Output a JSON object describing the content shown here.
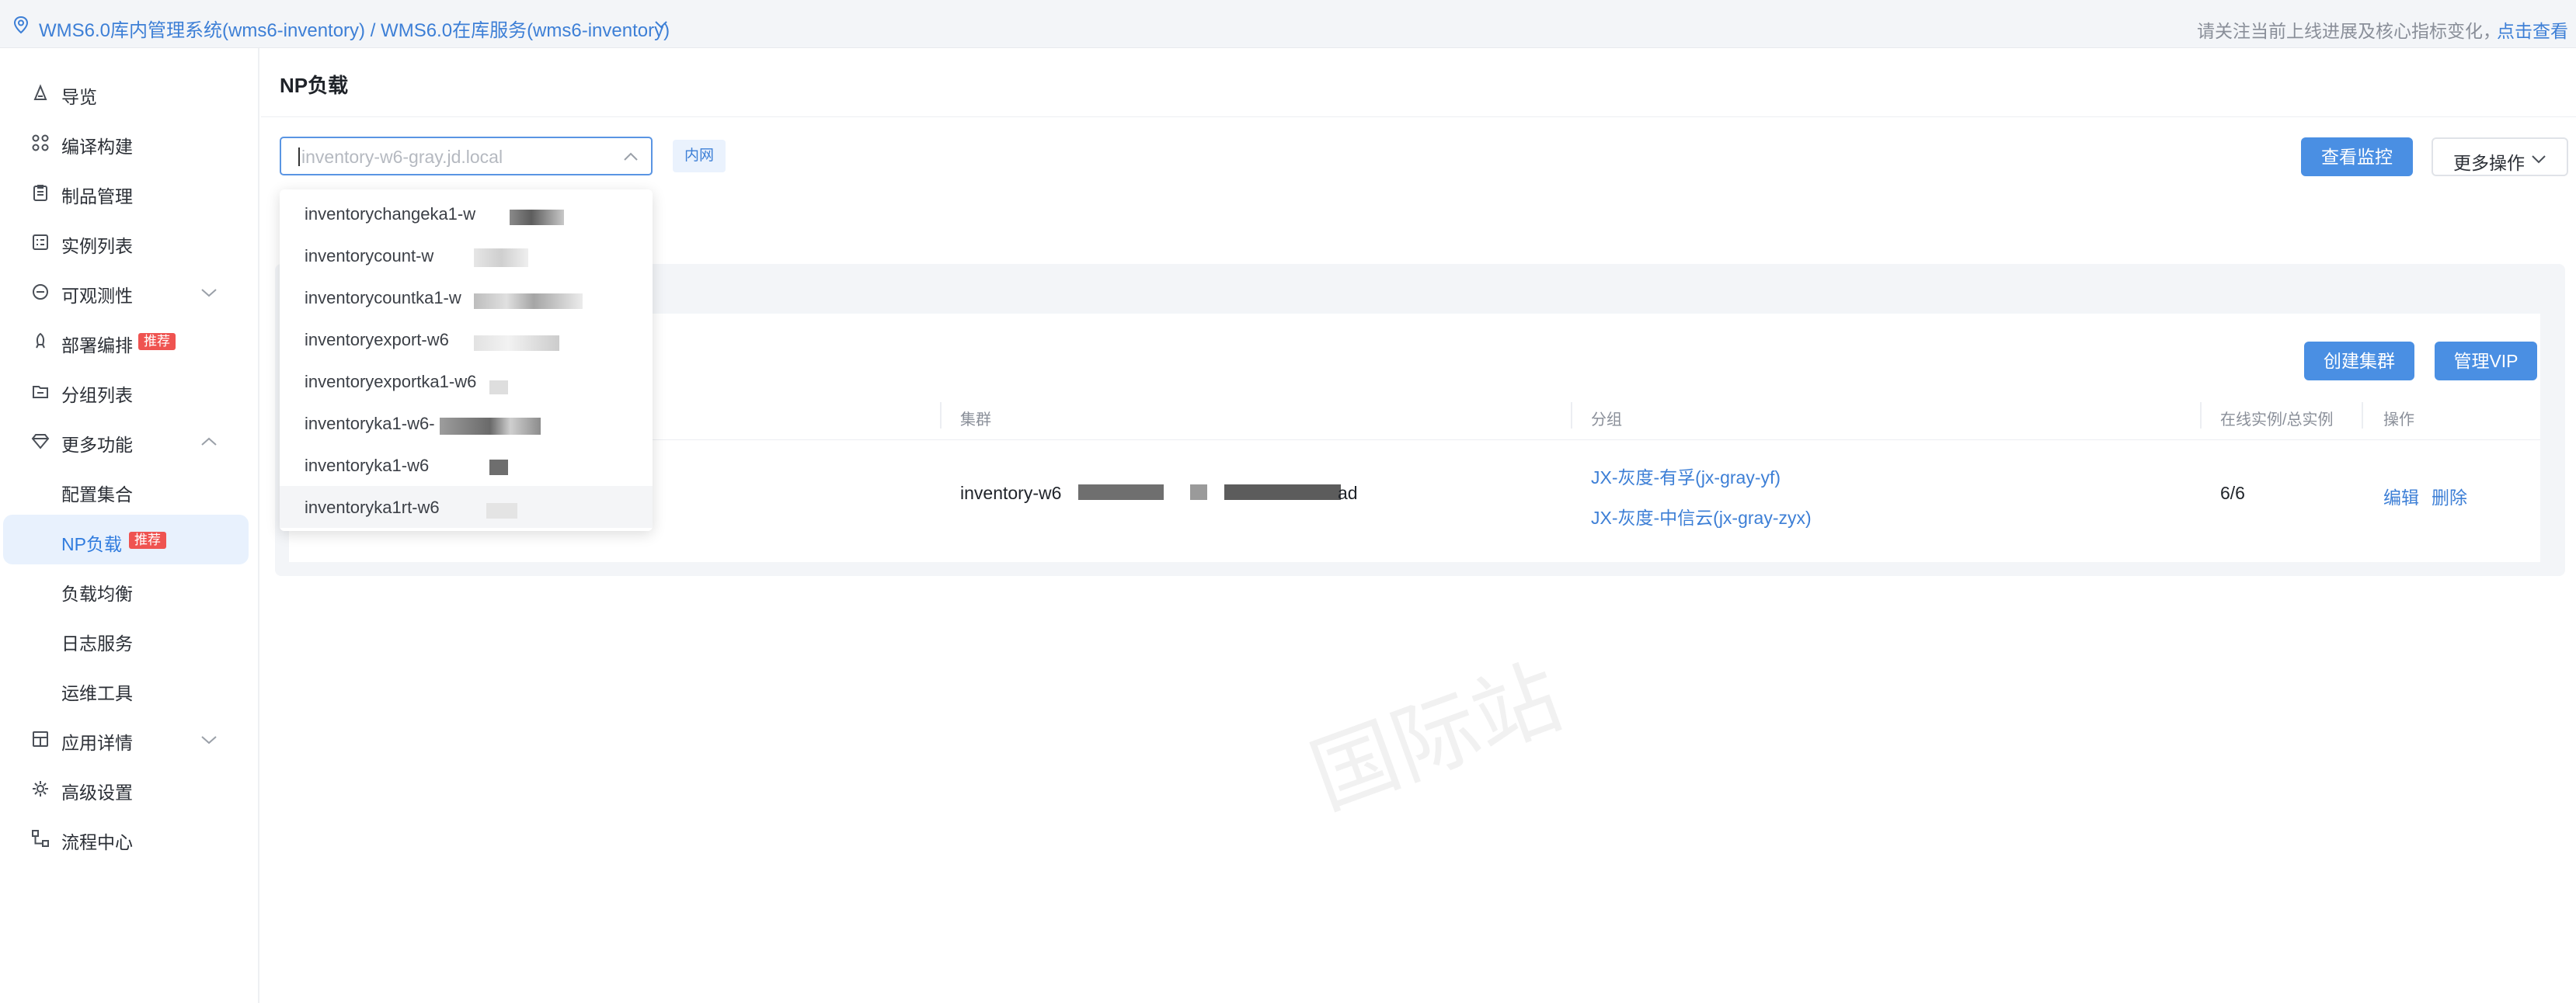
{
  "topbar": {
    "breadcrumb": "WMS6.0库内管理系统(wms6-inventory) / WMS6.0在库服务(wms6-inventory)",
    "notice": "请关注当前上线进展及核心指标变化，",
    "notice_link": "点击查看"
  },
  "sidebar": {
    "items": [
      {
        "label": "导览",
        "icon": "home-icon"
      },
      {
        "label": "编译构建",
        "icon": "build-icon"
      },
      {
        "label": "制品管理",
        "icon": "clipboard-icon"
      },
      {
        "label": "实例列表",
        "icon": "list-icon"
      },
      {
        "label": "可观测性",
        "icon": "observe-icon"
      },
      {
        "label": "部署编排",
        "icon": "rocket-icon",
        "badge": "推荐"
      },
      {
        "label": "分组列表",
        "icon": "folder-icon"
      },
      {
        "label": "更多功能",
        "icon": "diamond-icon"
      },
      {
        "label": "配置集合"
      },
      {
        "label": "NP负载",
        "badge": "推荐"
      },
      {
        "label": "负载均衡"
      },
      {
        "label": "日志服务"
      },
      {
        "label": "运维工具"
      },
      {
        "label": "应用详情",
        "icon": "layout-icon"
      },
      {
        "label": "高级设置",
        "icon": "gear-icon"
      },
      {
        "label": "流程中心",
        "icon": "flow-icon"
      }
    ]
  },
  "page": {
    "title": "NP负载",
    "host_placeholder": "inventory-w6-gray.jd.local",
    "net_tag": "内网",
    "monitor_button": "查看监控",
    "more_button": "更多操作",
    "create_cluster_button": "创建集群",
    "manage_vip_button": "管理VIP"
  },
  "table": {
    "headers": [
      "集群",
      "分组",
      "在线实例/总实例",
      "操作"
    ],
    "row": {
      "cluster_prefix": "inventory-w6",
      "cluster_suffix": "ad",
      "groups": [
        "JX-灰度-有孚(jx-gray-yf)",
        "JX-灰度-中信云(jx-gray-zyx)"
      ],
      "instances": "6/6",
      "edit": "编辑",
      "delete": "删除"
    }
  },
  "dropdown": {
    "options": [
      "inventorychangeka1-w",
      "inventorycount-w",
      "inventorycountka1-w",
      "inventoryexport-w6",
      "inventoryexportka1-w6",
      "inventoryka1-w6-",
      "inventoryka1-w6",
      "inventoryka1rt-w6"
    ]
  },
  "watermark": {
    "text": "国际站"
  },
  "colors": {
    "accent": "#4a8fe3",
    "link": "#3d7fd6",
    "badge": "#ef5350",
    "active_bg": "#e8f1fd"
  }
}
